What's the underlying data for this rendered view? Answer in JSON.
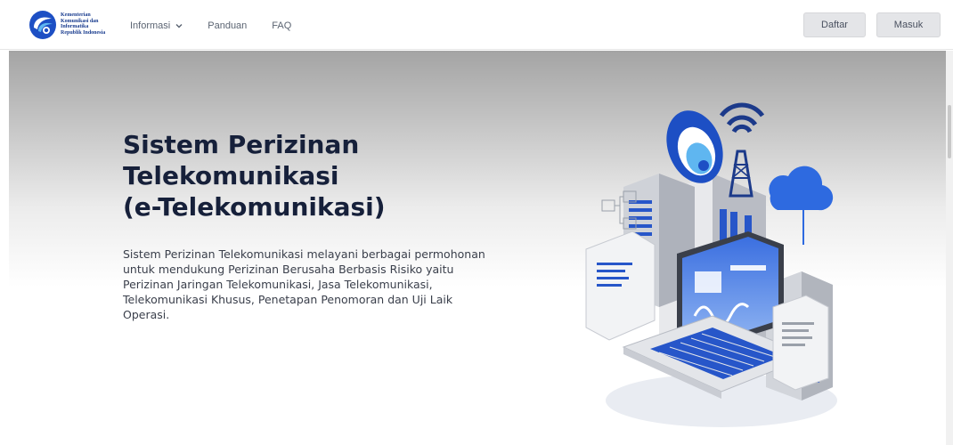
{
  "header": {
    "logo_lines": [
      "Kementerian",
      "Komunikasi dan",
      "Informatika",
      "Republik Indonesia"
    ],
    "nav": [
      {
        "label": "Informasi",
        "has_dropdown": true
      },
      {
        "label": "Panduan",
        "has_dropdown": false
      },
      {
        "label": "FAQ",
        "has_dropdown": false
      }
    ],
    "register_label": "Daftar",
    "login_label": "Masuk"
  },
  "hero": {
    "title": "Sistem Perizinan\nTelekomunikasi\n(e-Telekomunikasi)",
    "description": "Sistem Perizinan Telekomunikasi melayani berbagai permohonan untuk mendukung Perizinan Berusaha Berbasis Risiko yaitu Perizinan Jaringan Telekomunikasi, Jasa Telekomunikasi, Telekomunikasi Khusus, Penetapan Penomoran dan Uji Laik Operasi."
  },
  "colors": {
    "brand_blue": "#1d4fc4",
    "title_text": "#16203a",
    "button_bg": "#e4e5e8"
  },
  "icons": [
    "kominfo-logo-icon",
    "chevron-down-icon",
    "telecom-illustration"
  ]
}
